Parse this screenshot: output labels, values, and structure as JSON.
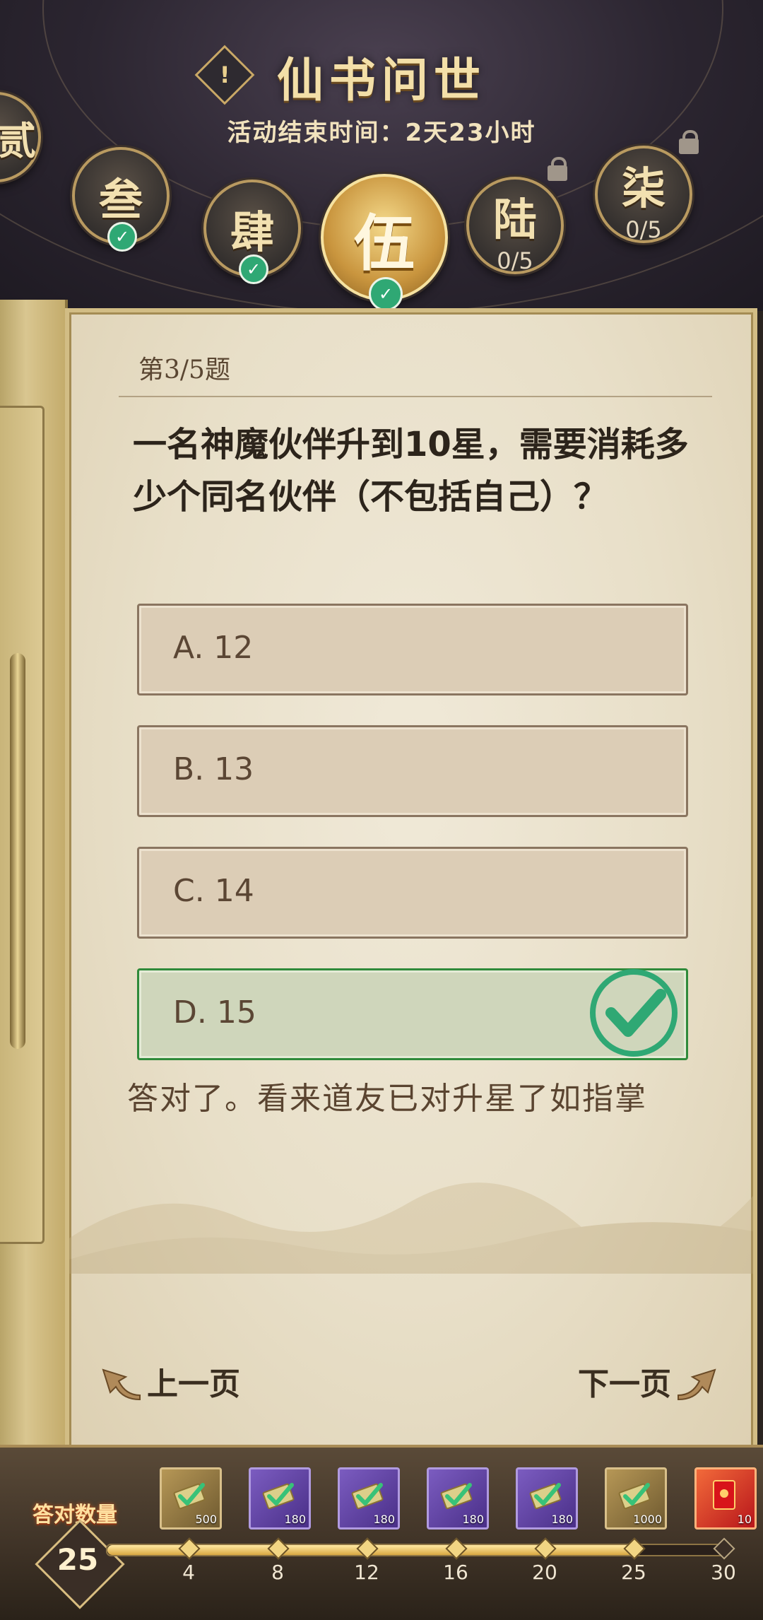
{
  "header": {
    "title": "仙书问世",
    "subtitle": "活动结束时间：2天23小时"
  },
  "chapters": [
    {
      "char": "贰",
      "status": "done"
    },
    {
      "char": "叁",
      "status": "done"
    },
    {
      "char": "肆",
      "status": "done"
    },
    {
      "char": "伍",
      "status": "active-done"
    },
    {
      "char": "陆",
      "status": "locked",
      "progress": "0/5"
    },
    {
      "char": "柒",
      "status": "locked",
      "progress": "0/5"
    }
  ],
  "quiz": {
    "question_number": "第3/5题",
    "question": "一名神魔伙伴升到10星，需要消耗多少个同名伙伴（不包括自己）？",
    "options": [
      {
        "label": "A. 12"
      },
      {
        "label": "B. 13"
      },
      {
        "label": "C. 14"
      },
      {
        "label": "D. 15",
        "correct": true
      }
    ],
    "feedback": "答对了。看来道友已对升星了如指掌"
  },
  "nav": {
    "prev_label": "上一页",
    "next_label": "下一页"
  },
  "rewards": {
    "count_label": "答对数量",
    "count_value": "25",
    "progress": 25,
    "max": 30,
    "items": [
      {
        "qty": "500",
        "style": "gold",
        "icon": "ticket-icon"
      },
      {
        "qty": "180",
        "style": "purple",
        "icon": "ticket-icon"
      },
      {
        "qty": "180",
        "style": "purple",
        "icon": "ticket-icon"
      },
      {
        "qty": "180",
        "style": "purple",
        "icon": "ticket-icon"
      },
      {
        "qty": "180",
        "style": "purple",
        "icon": "ticket-icon"
      },
      {
        "qty": "1000",
        "style": "gold",
        "icon": "ticket-icon"
      },
      {
        "qty": "10",
        "style": "red",
        "icon": "red-envelope-icon"
      }
    ],
    "milestones": [
      "4",
      "8",
      "12",
      "16",
      "20",
      "25",
      "30"
    ]
  },
  "colors": {
    "correct_green": "#2fa874",
    "paper": "#ebe2cd",
    "gold": "#f3dfa8"
  }
}
